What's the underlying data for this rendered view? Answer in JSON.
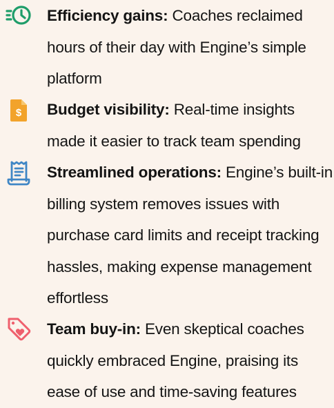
{
  "colors": {
    "background": "#fbf3ec",
    "text": "#141414",
    "icon_green": "#1f9d6a",
    "icon_orange": "#f2a32b",
    "icon_blue": "#3f86c5",
    "icon_pink": "#ef5f6d"
  },
  "benefits": [
    {
      "icon": "clock-speed-icon",
      "title": "Efficiency gains:",
      "body": " Coaches reclaimed hours of their day with Engine’s simple platform"
    },
    {
      "icon": "dollar-document-icon",
      "title": "Budget visibility:",
      "body": " Real-time insights made it easier to track team spending"
    },
    {
      "icon": "receipt-icon",
      "title": "Streamlined operations:",
      "body": " Engine’s built-in billing system removes issues with purchase card limits and receipt tracking hassles, making expense management effortless"
    },
    {
      "icon": "heart-tag-icon",
      "title": "Team buy-in:",
      "body": " Even skeptical coaches quickly embraced Engine, praising its ease of use and time-saving features"
    }
  ]
}
